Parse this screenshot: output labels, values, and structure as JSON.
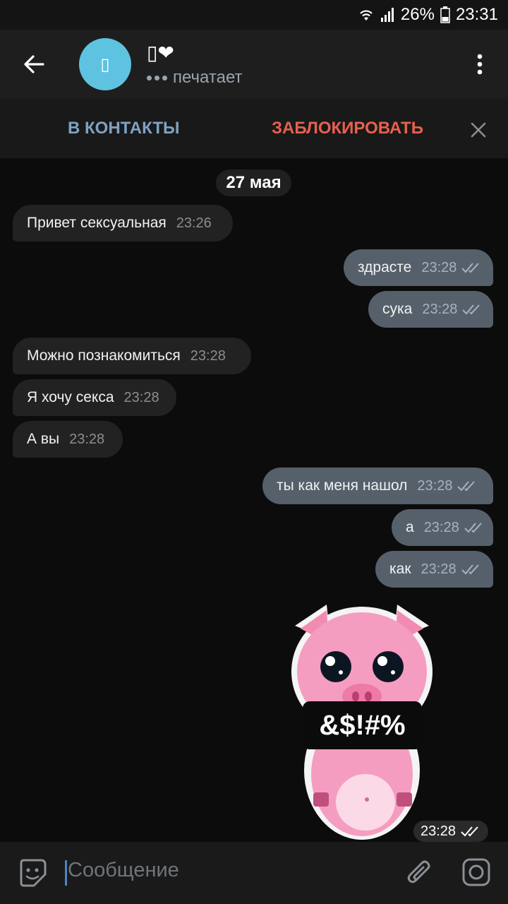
{
  "statusbar": {
    "battery": "26%",
    "time": "23:31"
  },
  "header": {
    "avatar_glyph": "▯",
    "title": "▯❤",
    "status": "печатает"
  },
  "actions": {
    "contacts": "В КОНТАКТЫ",
    "block": "ЗАБЛОКИРОВАТЬ"
  },
  "chat": {
    "date": "27 мая",
    "messages": [
      {
        "dir": "in",
        "text": "Привет сексуальная",
        "time": "23:26"
      },
      {
        "dir": "out",
        "text": "здрасте",
        "time": "23:28"
      },
      {
        "dir": "out",
        "text": "сука",
        "time": "23:28"
      },
      {
        "dir": "in",
        "text": "Можно познакомиться",
        "time": "23:28"
      },
      {
        "dir": "in",
        "text": "Я хочу секса",
        "time": "23:28"
      },
      {
        "dir": "in",
        "text": "А вы",
        "time": "23:28"
      },
      {
        "dir": "out",
        "text": "ты как меня нашол",
        "time": "23:28"
      },
      {
        "dir": "out",
        "text": "а",
        "time": "23:28"
      },
      {
        "dir": "out",
        "text": "как",
        "time": "23:28"
      }
    ],
    "sticker": {
      "caption": "&$!#%",
      "time": "23:28",
      "icon": "pig-sticker"
    }
  },
  "input": {
    "placeholder": "Сообщение"
  },
  "colors": {
    "accent_blue": "#7fa2c4",
    "danger_red": "#e7604f",
    "outgoing_bubble": "#55606b",
    "incoming_bubble": "#222222",
    "avatar": "#5ec3e0"
  }
}
